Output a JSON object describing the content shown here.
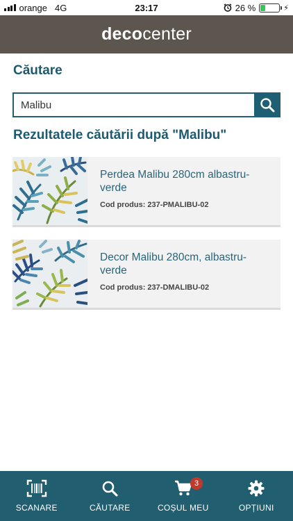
{
  "status_bar": {
    "carrier": "orange",
    "network": "4G",
    "time": "23:17",
    "battery_text": "26 %",
    "battery_level": 0.26
  },
  "header": {
    "logo_bold": "deco",
    "logo_light": "center"
  },
  "search": {
    "title": "Căutare",
    "value": "Malibu",
    "results_title": "Rezultatele căutării după \"Malibu\""
  },
  "results": [
    {
      "name": "Perdea Malibu 280cm albastru-verde",
      "code": "Cod produs: 237-PMALIBU-02"
    },
    {
      "name": "Decor Malibu 280cm, albastru-verde",
      "code": "Cod produs: 237-DMALIBU-02"
    }
  ],
  "nav": {
    "scan": "SCANARE",
    "search": "CĂUTARE",
    "cart": "COȘUL MEU",
    "cart_count": "3",
    "options": "OPȚIUNI"
  },
  "colors": {
    "header_bg": "#5d564f",
    "accent": "#1f5f73",
    "nav_bg": "#215e70",
    "badge": "#c0392b"
  },
  "icons": {
    "scan": "barcode-scan-icon",
    "search": "search-icon",
    "cart": "cart-icon",
    "options": "gear-icon"
  }
}
